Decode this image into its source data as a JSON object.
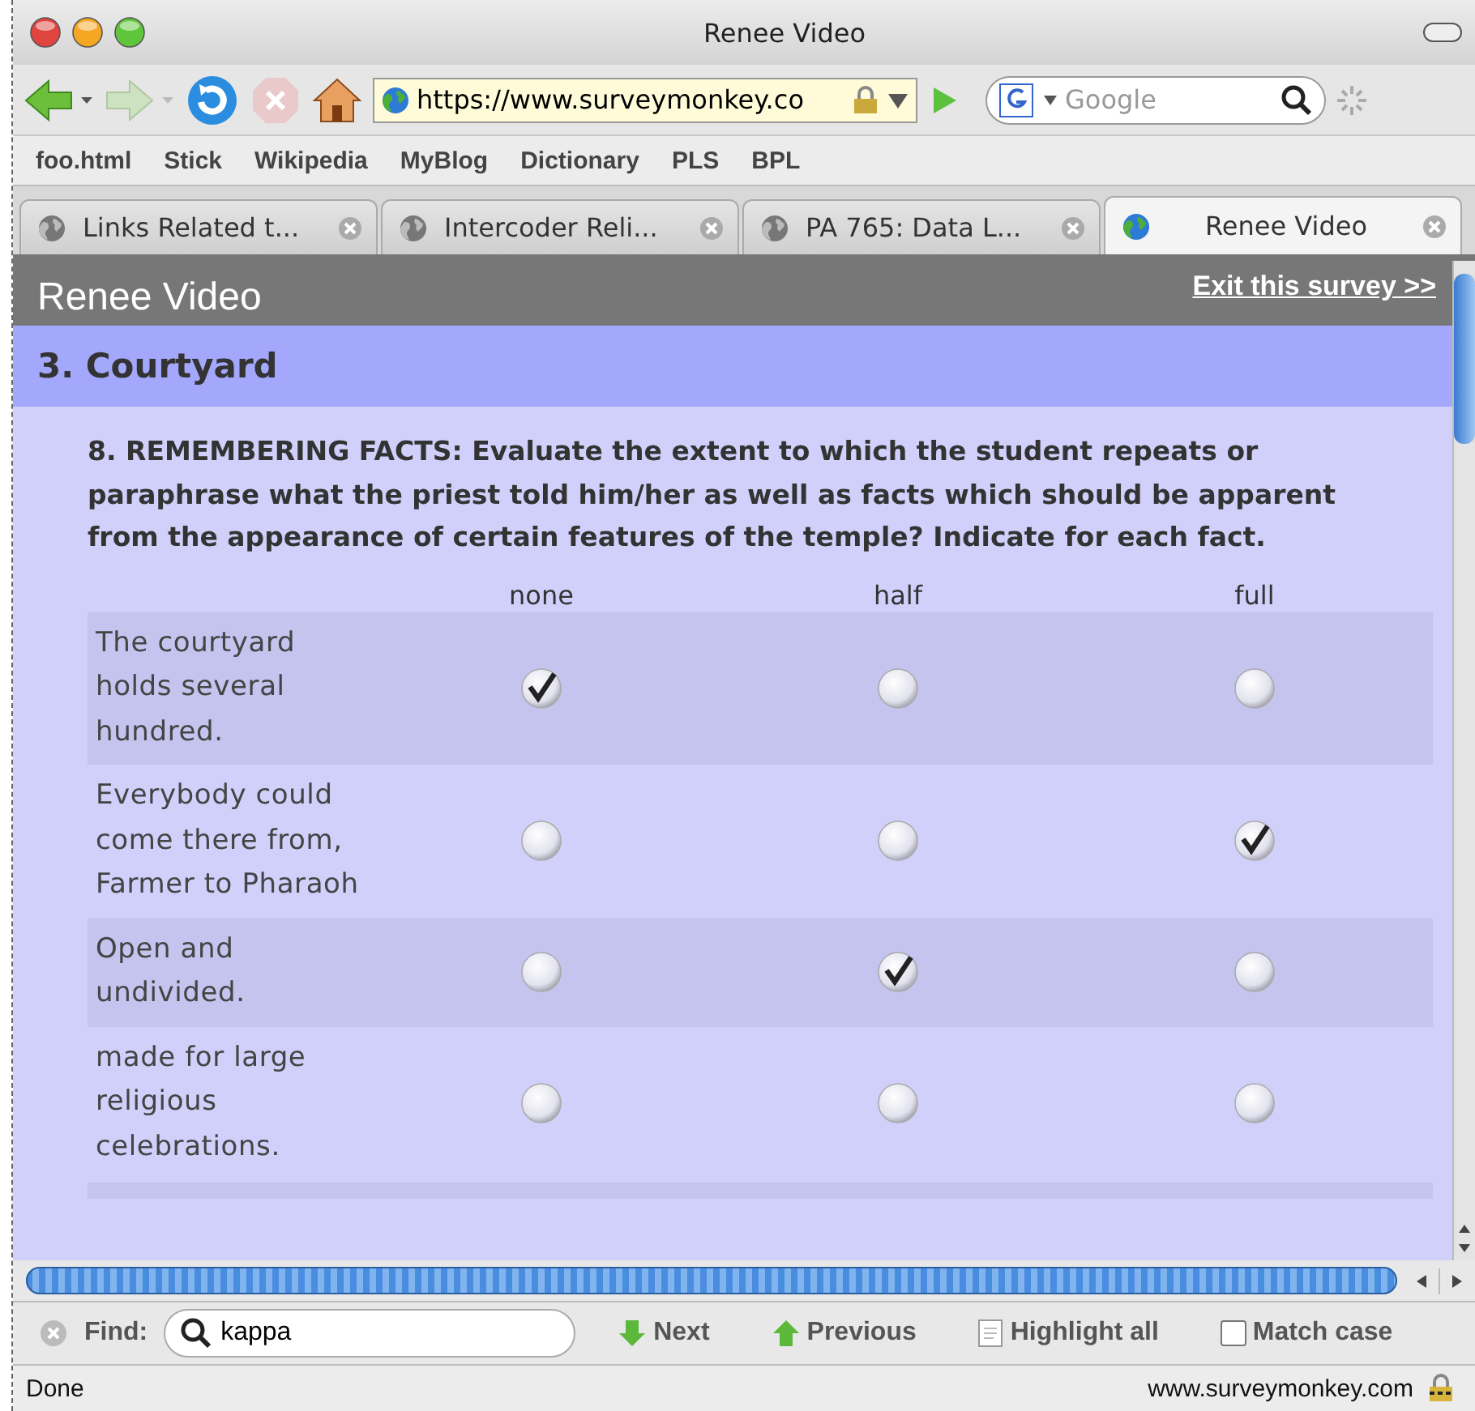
{
  "window": {
    "title": "Renee Video"
  },
  "toolbar": {
    "url": "https://www.surveymonkey.co",
    "search": {
      "placeholder": "Google"
    }
  },
  "bookmarks": [
    "foo.html",
    "Stick",
    "Wikipedia",
    "MyBlog",
    "Dictionary",
    "PLS",
    "BPL"
  ],
  "tabs": [
    {
      "label": "Links Related t...",
      "selected": false
    },
    {
      "label": "Intercoder Reli...",
      "selected": false
    },
    {
      "label": "PA 765: Data L...",
      "selected": false
    },
    {
      "label": "Renee Video",
      "selected": true
    }
  ],
  "survey": {
    "title": "Renee Video",
    "exit_link": "Exit this survey >>",
    "page_heading": "3. Courtyard",
    "question": "8. REMEMBERING FACTS: Evaluate the extent to which the student repeats or paraphrase what the priest told him/her as well as facts which should be apparent from the appearance of certain features of the temple? Indicate for each fact.",
    "columns": [
      "none",
      "half",
      "full"
    ],
    "rows": [
      {
        "label": "The courtyard holds several hundred.",
        "choices": [
          {
            "selected": true
          },
          {
            "selected": false
          },
          {
            "selected": false
          }
        ]
      },
      {
        "label": "Everybody could come there from, Farmer to Pharaoh",
        "choices": [
          {
            "selected": false
          },
          {
            "selected": false
          },
          {
            "selected": true
          }
        ]
      },
      {
        "label": "Open and undivided.",
        "choices": [
          {
            "selected": false
          },
          {
            "selected": true
          },
          {
            "selected": false
          }
        ]
      },
      {
        "label": "made for large religious celebrations.",
        "choices": [
          {
            "selected": false
          },
          {
            "selected": false
          },
          {
            "selected": false
          }
        ]
      }
    ]
  },
  "find_bar": {
    "label": "Find:",
    "value": "kappa",
    "next": "Next",
    "previous": "Previous",
    "highlight": "Highlight all",
    "match_case": {
      "label": "Match case",
      "checked": false
    }
  },
  "status_bar": {
    "text": "Done",
    "host": "www.surveymonkey.com"
  }
}
